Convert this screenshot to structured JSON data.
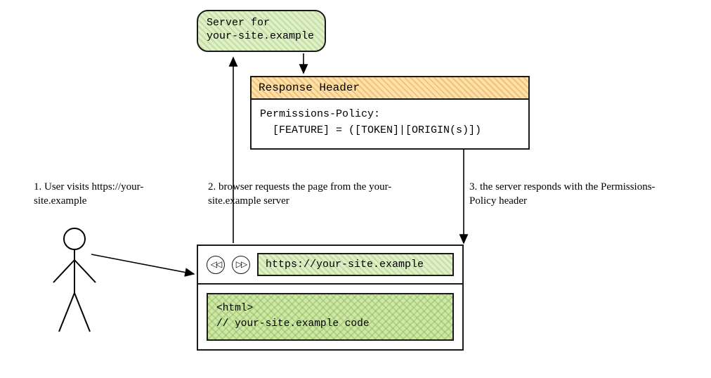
{
  "server": {
    "line1": "Server for",
    "line2": "your-site.example"
  },
  "response": {
    "title": "Response Header",
    "line1": "Permissions-Policy:",
    "line2": "[FEATURE] = ([TOKEN]|[ORIGIN(s)])"
  },
  "steps": {
    "s1": "1. User visits https://your-site.example",
    "s2": "2. browser requests the page from the your-site.example server",
    "s3": "3. the server responds with the Permissions-Policy header"
  },
  "browser": {
    "back_glyph": "◁◁",
    "fwd_glyph": "▷▷",
    "url": "https://your-site.example",
    "code_line1": "<html>",
    "code_line2": "// your-site.example code"
  }
}
